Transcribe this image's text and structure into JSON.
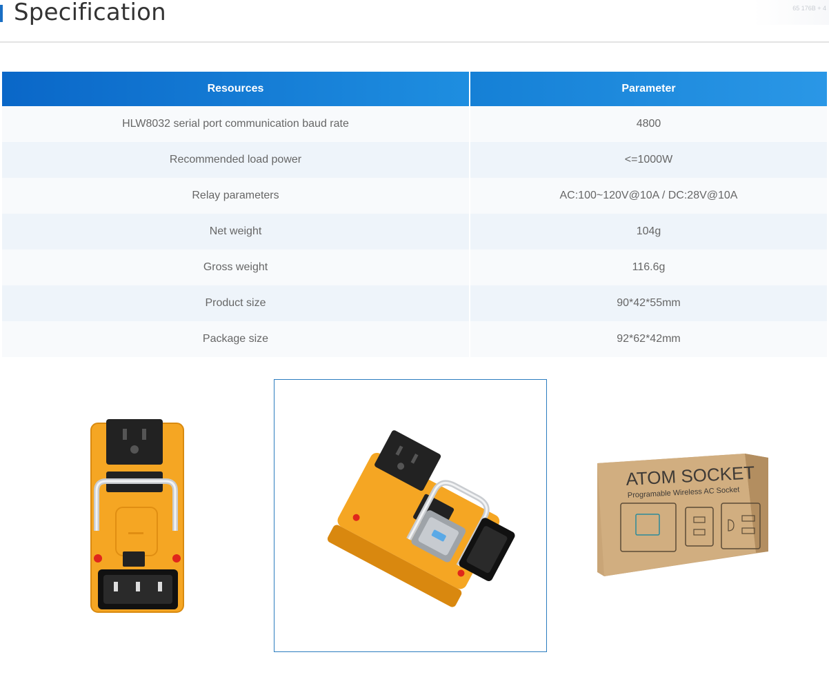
{
  "page": {
    "title": "Specification"
  },
  "top_widget": {
    "text": "65 176B + 4"
  },
  "table": {
    "headers": {
      "resources": "Resources",
      "parameter": "Parameter"
    },
    "rows": [
      {
        "resource": "HLW8032 serial port communication baud rate",
        "parameter": "4800"
      },
      {
        "resource": "Recommended load power",
        "parameter": "<=1000W"
      },
      {
        "resource": "Relay parameters",
        "parameter": "AC:100~120V@10A / DC:28V@10A"
      },
      {
        "resource": "Net weight",
        "parameter": "104g"
      },
      {
        "resource": "Gross weight",
        "parameter": "116.6g"
      },
      {
        "resource": "Product size",
        "parameter": "90*42*55mm"
      },
      {
        "resource": "Package size",
        "parameter": "92*62*42mm"
      }
    ]
  },
  "gallery": {
    "selected_index": 1,
    "box": {
      "title": "ATOM SOCKET",
      "subtitle": "Programable Wireless AC Socket"
    }
  },
  "colors": {
    "accent": "#1a6fc4",
    "header_start": "#0a67c8",
    "header_end": "#2a97e6",
    "product_orange": "#f5a623"
  }
}
